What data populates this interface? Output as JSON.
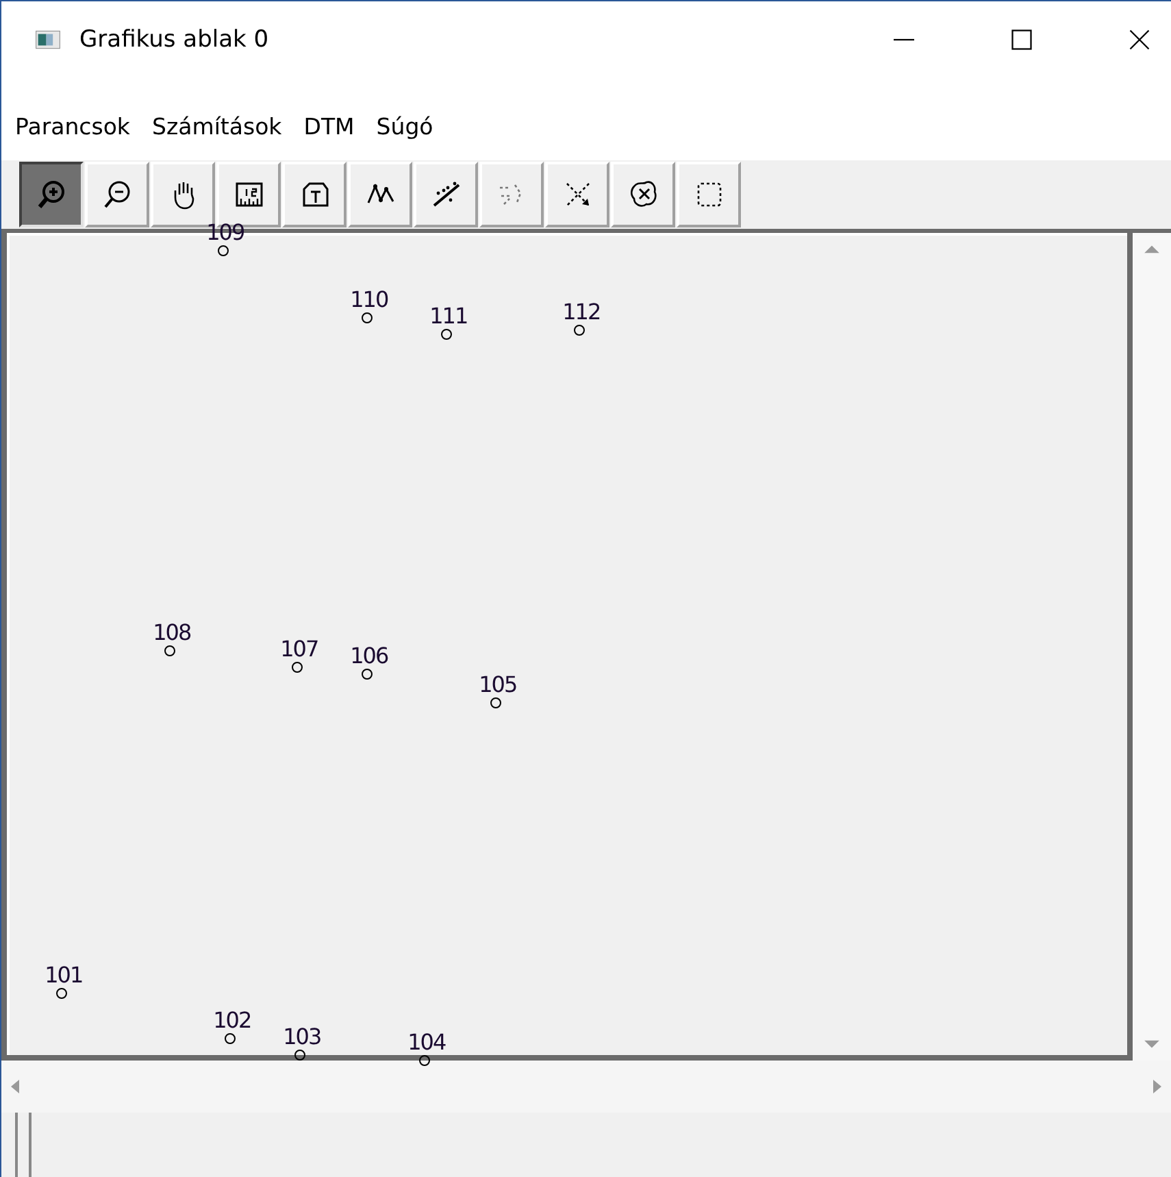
{
  "window": {
    "title": "Grafikus ablak 0"
  },
  "menu": [
    "Parancsok",
    "Számítások",
    "DTM",
    "Súgó"
  ],
  "toolbar": [
    {
      "kind": "zoom-in",
      "selected": true
    },
    {
      "kind": "zoom-out",
      "selected": false
    },
    {
      "kind": "pan",
      "selected": false
    },
    {
      "kind": "numbers",
      "selected": false
    },
    {
      "kind": "text",
      "selected": false
    },
    {
      "kind": "line",
      "selected": false
    },
    {
      "kind": "points-line",
      "selected": false
    },
    {
      "kind": "dotted-select",
      "selected": false
    },
    {
      "kind": "arrows",
      "selected": false
    },
    {
      "kind": "delete",
      "selected": false
    },
    {
      "kind": "frame",
      "selected": false
    }
  ],
  "points": [
    "109",
    "110",
    "111",
    "112",
    "108",
    "107",
    "106",
    "105",
    "101",
    "102",
    "103",
    "104"
  ]
}
